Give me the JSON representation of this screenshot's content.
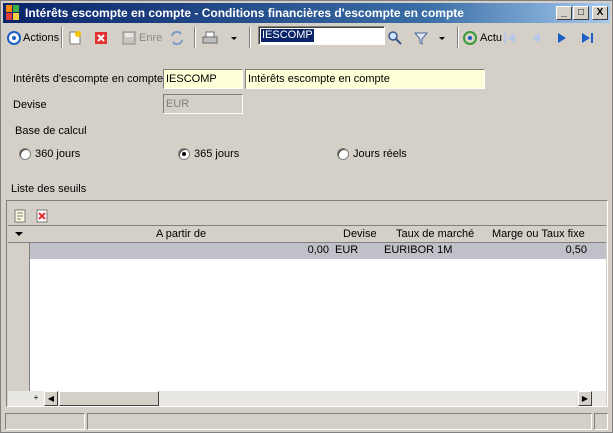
{
  "window": {
    "title": "Intérêts escompte en compte - Conditions financières d'escompte en compte",
    "minimize": "_",
    "maximize": "□",
    "close": "X"
  },
  "toolbar": {
    "actions_label": "Actions",
    "save_label": "Enre",
    "search_value": "IESCOMP",
    "refresh_label": "Actu"
  },
  "form": {
    "code_label": "Intérêts d'escompte en compte",
    "code_value": "IESCOMP",
    "description_value": "Intérêts escompte en compte",
    "currency_label": "Devise",
    "currency_value": "EUR",
    "calc_base_label": "Base de calcul",
    "radio_360": "360 jours",
    "radio_365": "365 jours",
    "radio_real": "Jours réels",
    "selected_radio": "365 jours"
  },
  "grid": {
    "title": "Liste des seuils",
    "columns": [
      "A partir de",
      "Devise",
      "Taux de marché",
      "Marge ou Taux fixe"
    ],
    "rows": [
      {
        "from": "0,00",
        "currency": "EUR",
        "market_rate": "EURIBOR 1M",
        "margin": "0,50"
      }
    ],
    "add_symbol": "+"
  }
}
